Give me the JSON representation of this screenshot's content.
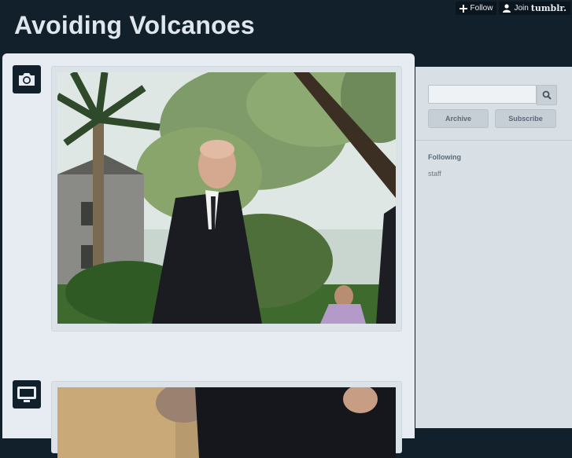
{
  "blog": {
    "title": "Avoiding Volcanoes"
  },
  "tumblr_controls": {
    "follow_label": "Follow",
    "join_label": "Join",
    "brand": "tumblr."
  },
  "posts": [
    {
      "type_icon": "camera-icon"
    },
    {
      "type_icon": "video-icon"
    }
  ],
  "sidebar": {
    "search": {
      "value": "",
      "placeholder": ""
    },
    "archive_label": "Archive",
    "subscribe_label": "Subscribe",
    "following_title": "Following",
    "following": [
      "staff"
    ]
  },
  "colors": {
    "header_bg": "#12202b",
    "content_bg": "#e6ecf1",
    "sidebar_bg": "#d8dfe5",
    "title_text": "#dfe6ee"
  }
}
